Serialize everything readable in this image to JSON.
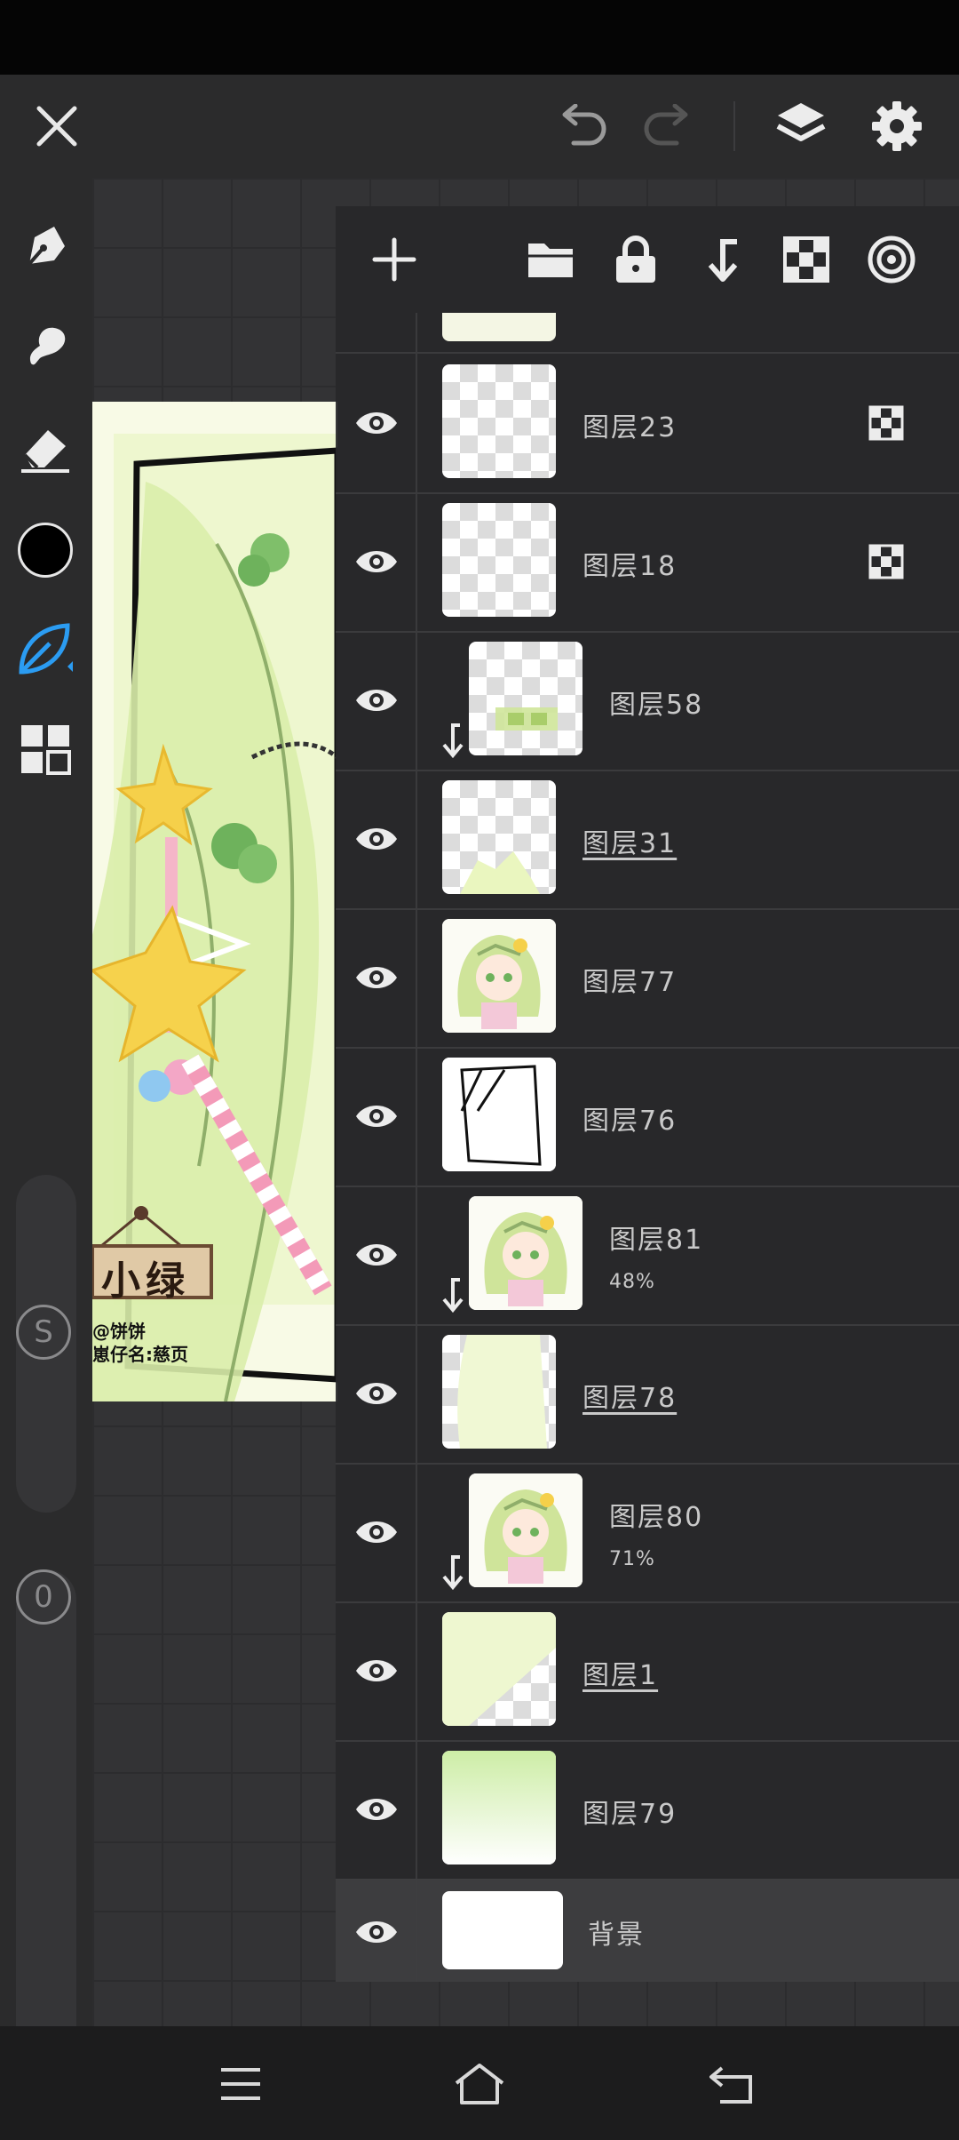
{
  "layers": [
    {
      "name": "图层23",
      "underline": false,
      "clipped": false,
      "alpha_lock": true,
      "thumb": "empty"
    },
    {
      "name": "图层18",
      "underline": false,
      "clipped": false,
      "alpha_lock": true,
      "thumb": "empty"
    },
    {
      "name": "图层58",
      "underline": false,
      "clipped": true,
      "alpha_lock": false,
      "thumb": "green-text"
    },
    {
      "name": "图层31",
      "underline": true,
      "clipped": false,
      "alpha_lock": false,
      "thumb": "green-bottom"
    },
    {
      "name": "图层77",
      "underline": false,
      "clipped": false,
      "alpha_lock": false,
      "thumb": "character"
    },
    {
      "name": "图层76",
      "underline": false,
      "clipped": false,
      "alpha_lock": false,
      "thumb": "frame-lines"
    },
    {
      "name": "图层81",
      "opacity": "48%",
      "underline": false,
      "clipped": true,
      "alpha_lock": false,
      "thumb": "character"
    },
    {
      "name": "图层78",
      "underline": true,
      "clipped": false,
      "alpha_lock": false,
      "thumb": "green-fill"
    },
    {
      "name": "图层80",
      "opacity": "71%",
      "underline": false,
      "clipped": true,
      "alpha_lock": false,
      "thumb": "character"
    },
    {
      "name": "图层1",
      "underline": true,
      "clipped": false,
      "alpha_lock": false,
      "thumb": "green-diagonal"
    },
    {
      "name": "图层79",
      "underline": false,
      "clipped": false,
      "alpha_lock": false,
      "thumb": "green-gradient"
    }
  ],
  "background_layer": {
    "name": "背景"
  },
  "artwork": {
    "sign_text": "小绿",
    "credit_line1": "@饼饼",
    "credit_line2": "崽仔名:慈页"
  },
  "sidebar": {
    "slider_size_badge": "S",
    "slider_opacity_badge": "0"
  },
  "colors": {
    "accent": "#2b9cf2",
    "current_color": "#000000",
    "panel_bg": "#28282a",
    "selected_row": "#3e3e40"
  },
  "icons": {
    "close": "close-icon",
    "undo": "undo-icon",
    "redo": "redo-icon",
    "layers": "layers-icon",
    "settings": "gear-icon",
    "add": "plus-icon",
    "folder": "folder-icon",
    "lock": "lock-icon",
    "merge": "merge-down-icon",
    "alpha": "checker-icon",
    "blend": "target-icon"
  }
}
